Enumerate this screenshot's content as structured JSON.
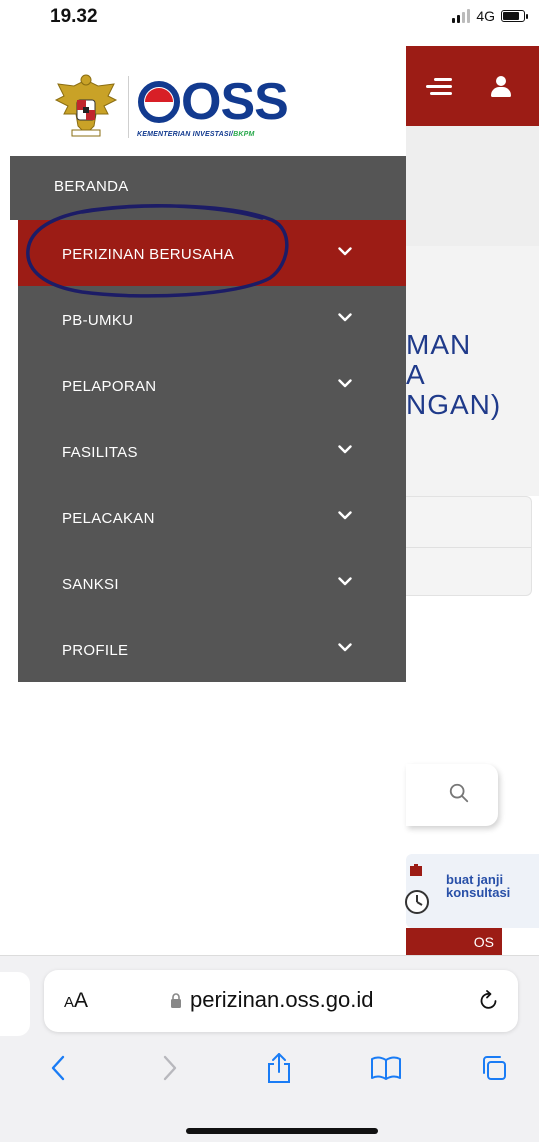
{
  "status_bar": {
    "time": "19.32",
    "network": "4G"
  },
  "page": {
    "title_lines": [
      "MAN",
      "A",
      "NGAN)"
    ],
    "consult_line1": "buat janji",
    "consult_line2": "konsultasi",
    "button_fragment": "OS"
  },
  "logo": {
    "brand": "OSS",
    "subtitle_main": "KEMENTERIAN INVESTASI/",
    "subtitle_accent": "BKPM"
  },
  "sidebar": {
    "home_label": "BERANDA",
    "items": [
      {
        "label": "PERIZINAN BERUSAHA",
        "active": true
      },
      {
        "label": "PB-UMKU",
        "active": false
      },
      {
        "label": "PELAPORAN",
        "active": false
      },
      {
        "label": "FASILITAS",
        "active": false
      },
      {
        "label": "PELACAKAN",
        "active": false
      },
      {
        "label": "SANKSI",
        "active": false
      },
      {
        "label": "PROFILE",
        "active": false
      }
    ]
  },
  "browser": {
    "aa_large": "A",
    "aa_small": "A",
    "url": "perizinan.oss.go.id"
  },
  "colors": {
    "header_red": "#9c1c15",
    "menu_gray": "#555555",
    "brand_blue": "#123a8f",
    "title_blue": "#1f3a8a",
    "ios_blue": "#1a7cf5",
    "scribble_navy": "#1c1c66"
  },
  "icons": {
    "menu": "hamburger-icon",
    "user": "user-icon",
    "search": "search-icon",
    "chevron": "chevron-down-icon",
    "lock": "lock-icon",
    "reload": "reload-icon",
    "back": "back-icon",
    "forward": "forward-icon",
    "share": "share-icon",
    "bookmarks": "bookmarks-icon",
    "tabs": "tabs-icon"
  }
}
